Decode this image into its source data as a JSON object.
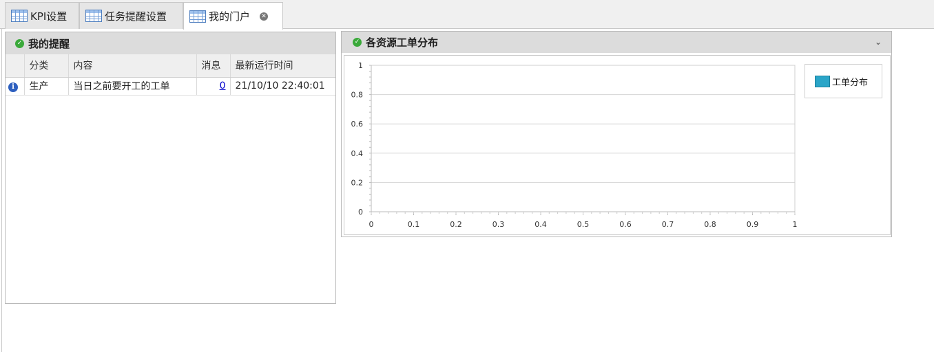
{
  "tabs": [
    {
      "label": "KPI设置",
      "icon": "table-grid-icon",
      "active": false
    },
    {
      "label": "任务提醒设置",
      "icon": "table-grid-icon",
      "active": false
    },
    {
      "label": "我的门户",
      "icon": "table-grid-icon",
      "active": true,
      "closable": true
    }
  ],
  "reminders": {
    "title": "我的提醒",
    "columns": [
      "分类",
      "内容",
      "消息",
      "最新运行时间"
    ],
    "rows": [
      {
        "icon": "info-icon",
        "category": "生产",
        "content": "当日之前要开工的工单",
        "message": "0",
        "last_run": "21/10/10 22:40:01"
      }
    ]
  },
  "distribution": {
    "title": "各资源工单分布",
    "legend_label": "工单分布",
    "series_color": "#2aa5c8"
  },
  "chart_data": {
    "type": "bar",
    "title": "",
    "xlabel": "",
    "ylabel": "",
    "xlim": [
      0,
      1
    ],
    "ylim": [
      0,
      1
    ],
    "x_ticks": [
      "0",
      "0.1",
      "0.2",
      "0.3",
      "0.4",
      "0.5",
      "0.6",
      "0.7",
      "0.8",
      "0.9",
      "1"
    ],
    "y_ticks": [
      "0",
      "0.2",
      "0.4",
      "0.6",
      "0.8",
      "1"
    ],
    "grid": true,
    "legend_position": "top-right",
    "series": [
      {
        "name": "工单分布",
        "values": []
      }
    ]
  }
}
